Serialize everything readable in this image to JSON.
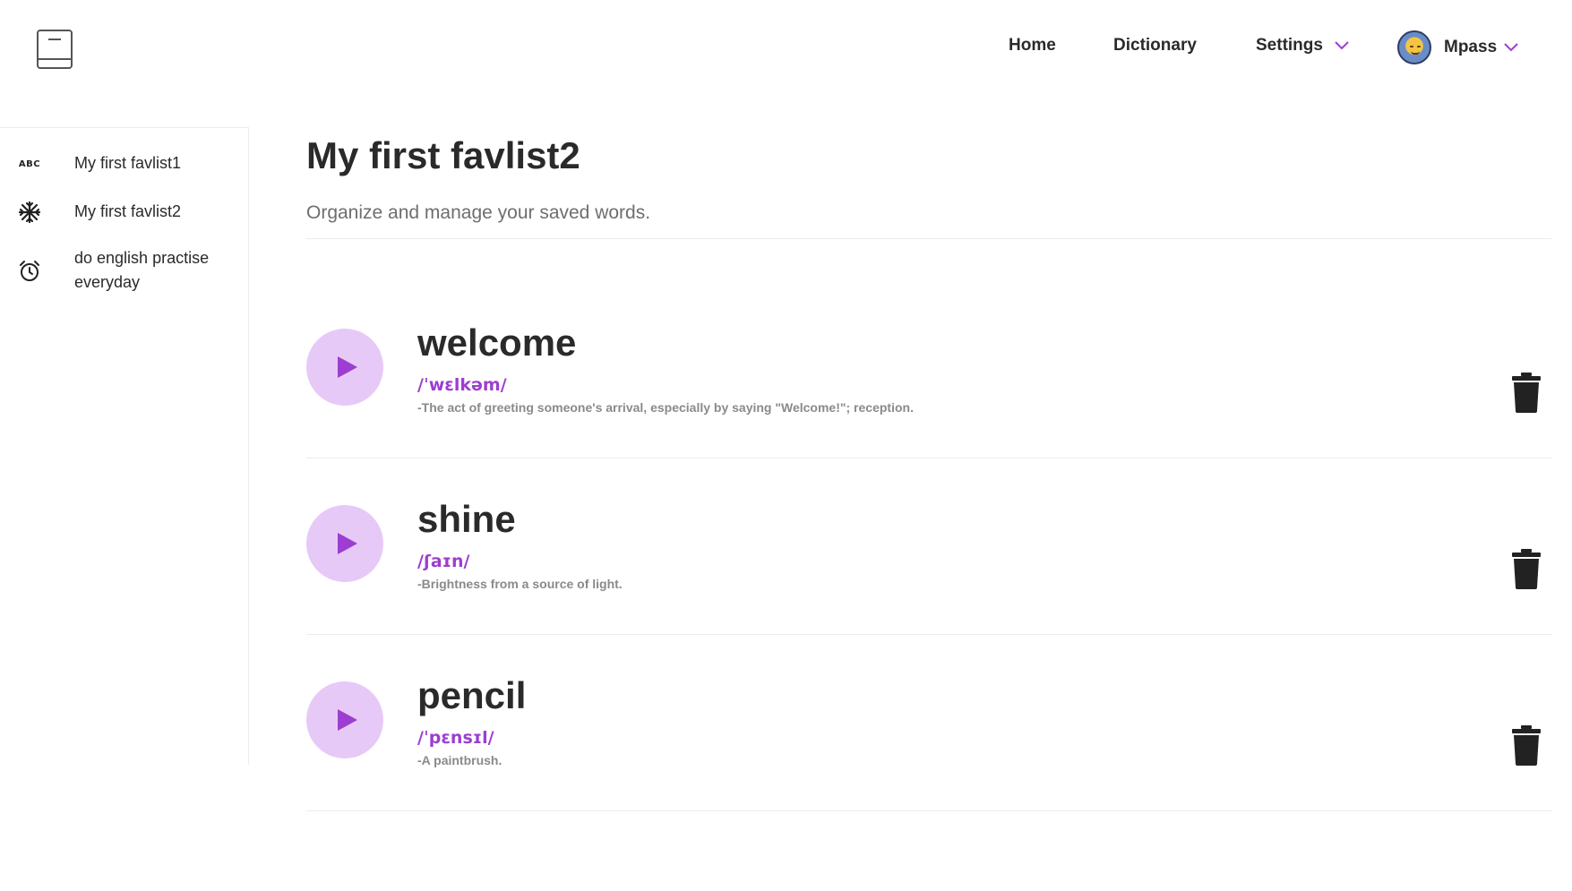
{
  "header": {
    "logo_icon": "book-icon",
    "nav": {
      "home": "Home",
      "dictionary": "Dictionary",
      "settings": "Settings"
    },
    "user": {
      "name": "Mpass",
      "avatar_icon": "avatar-icon"
    }
  },
  "sidebar": {
    "items": [
      {
        "label": "My first favlist1",
        "icon": "abc-icon",
        "icon_text": "ABC"
      },
      {
        "label": "My first favlist2",
        "icon": "snowflake-icon"
      },
      {
        "label": "do english practise everyday",
        "icon": "alarm-clock-icon"
      }
    ]
  },
  "main": {
    "title": "My first favlist2",
    "subtitle": "Organize and manage your saved words.",
    "words": [
      {
        "word": "welcome",
        "phonetic": "/ˈwɛlkəm/",
        "definition": "-The act of greeting someone's arrival, especially by saying \"Welcome!\"; reception."
      },
      {
        "word": "shine",
        "phonetic": "/ʃaɪn/",
        "definition": "-Brightness from a source of light."
      },
      {
        "word": "pencil",
        "phonetic": "/ˈpɛnsɪl/",
        "definition": "-A paintbrush."
      }
    ]
  },
  "colors": {
    "accent": "#9c3ed1",
    "play_button_bg": "#e7c9f7",
    "text_dark": "#2a2a2a",
    "text_muted": "#8a8a8a",
    "divider": "#ececec"
  }
}
